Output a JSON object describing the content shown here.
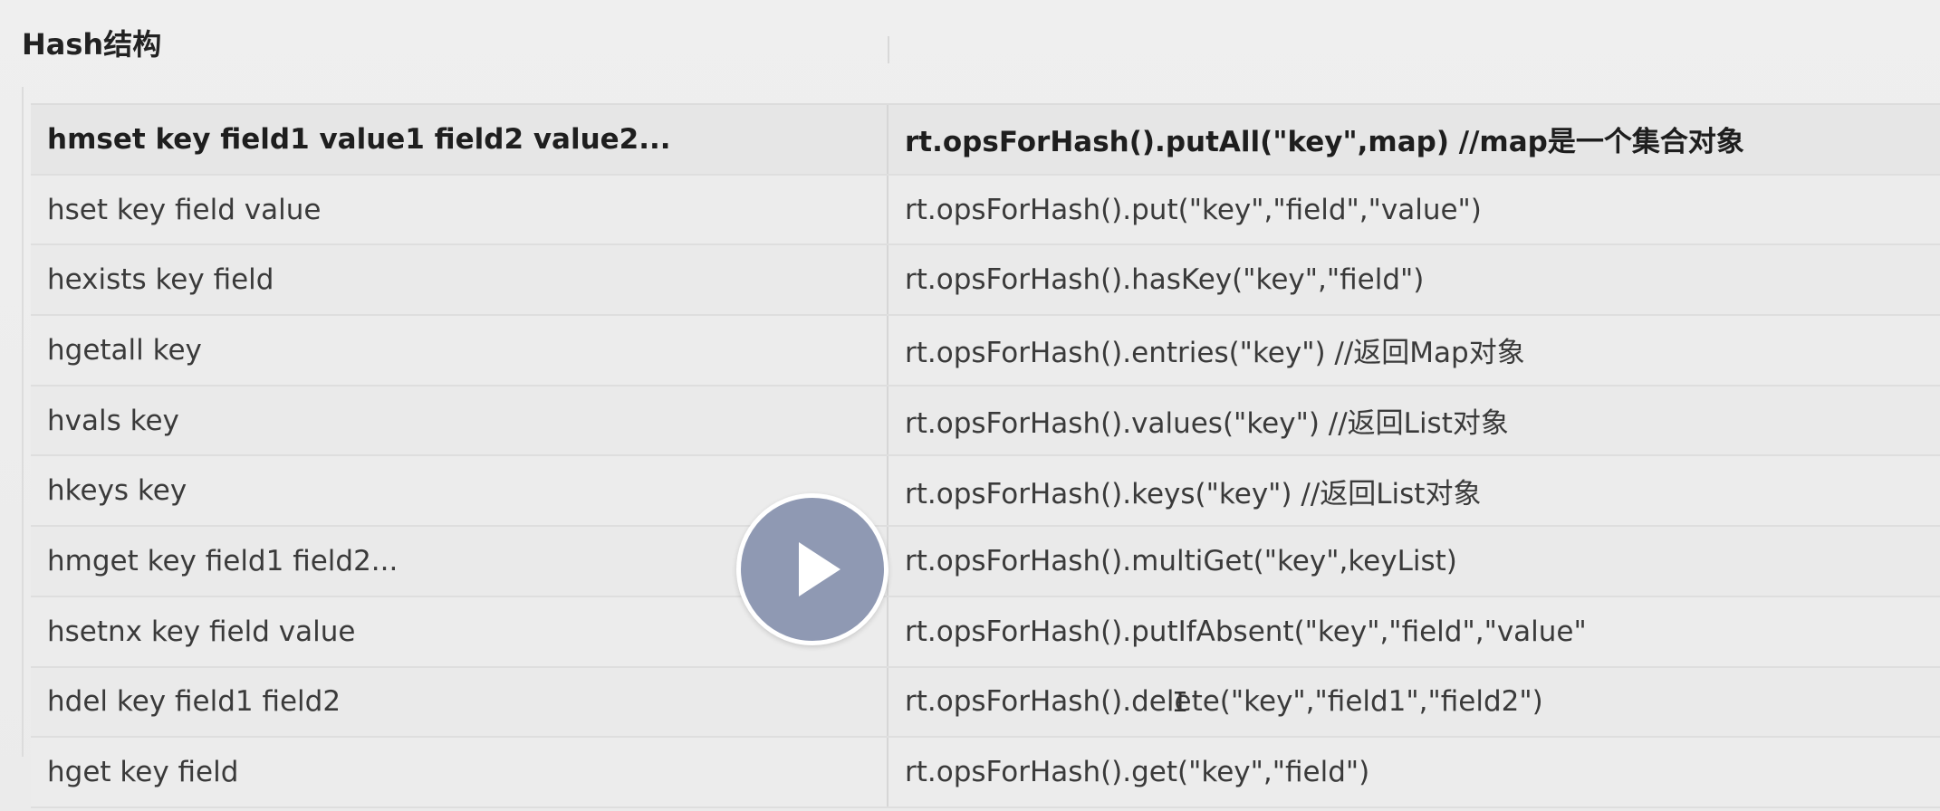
{
  "section": {
    "title": "Hash结构"
  },
  "table": {
    "header": {
      "command": "hmset key field1 value1 field2 value2...",
      "java": "rt.opsForHash().putAll(\"key\",map) //map是一个集合对象"
    },
    "rows": [
      {
        "command": "hset key field value",
        "java": "rt.opsForHash().put(\"key\",\"field\",\"value\")"
      },
      {
        "command": "hexists key field",
        "java": "rt.opsForHash().hasKey(\"key\",\"field\")"
      },
      {
        "command": "hgetall key",
        "java": "rt.opsForHash().entries(\"key\") //返回Map对象"
      },
      {
        "command": "hvals key",
        "java": "rt.opsForHash().values(\"key\") //返回List对象"
      },
      {
        "command": "hkeys key",
        "java": "rt.opsForHash().keys(\"key\") //返回List对象"
      },
      {
        "command": "hmget key field1 field2...",
        "java": "rt.opsForHash().multiGet(\"key\",keyList)"
      },
      {
        "command": "hsetnx key field value",
        "java": "rt.opsForHash().putIfAbsent(\"key\",\"field\",\"value\""
      },
      {
        "command": "hdel key field1 field2",
        "java": "rt.opsForHash().delete(\"key\",\"field1\",\"field2\")"
      },
      {
        "command": "hget key field",
        "java": "rt.opsForHash().get(\"key\",\"field\")"
      }
    ]
  },
  "video": {
    "play_icon": "play-icon",
    "play_color": "#8f99b3"
  },
  "cursor": {
    "icon": "text-cursor-icon",
    "glyph": "I"
  }
}
